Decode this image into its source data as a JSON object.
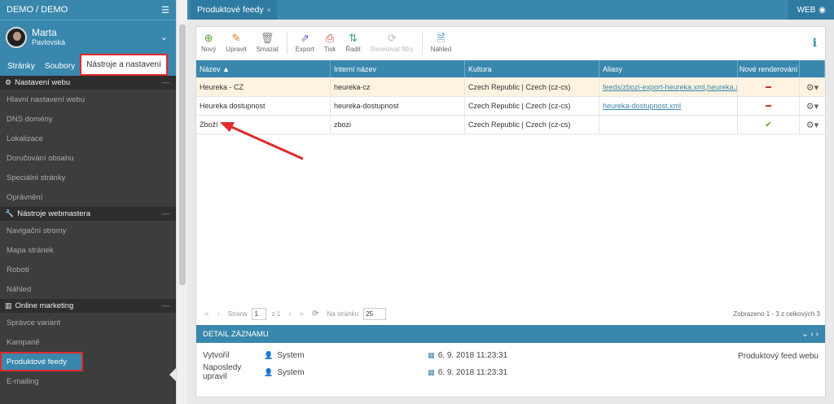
{
  "sidebar": {
    "brand": "DEMO / DEMO",
    "user_first": "Marta",
    "user_last": "Pavlovská",
    "tabs": [
      "Stránky",
      "Soubory",
      "Nástroje a nastavení"
    ],
    "section1": "Nastavení webu",
    "section1_items": [
      "Hlavní nastavení webu",
      "DNS domény",
      "Lokalizace",
      "Doručování obsahu",
      "Speciální stránky",
      "Oprávnění"
    ],
    "section2": "Nástroje webmastera",
    "section2_items": [
      "Navigační stromy",
      "Mapa stránek",
      "Roboti",
      "Náhled"
    ],
    "section3": "Online marketing",
    "section3_items": [
      "Správce variant",
      "Kampaně",
      "Produktové feedy",
      "E-mailing"
    ]
  },
  "topbar": {
    "tab": "Produktové feedy",
    "web_label": "WEB"
  },
  "toolbar": [
    "Nový",
    "Upravit",
    "Smazat",
    "Export",
    "Tisk",
    "Řadit",
    "Resetovat filtry",
    "Náhled"
  ],
  "grid": {
    "headers": [
      "Název ▲",
      "Interní název",
      "Kultura",
      "Aliasy",
      "Nové renderování"
    ],
    "rows": [
      {
        "name": "Heureka - CZ",
        "internal": "heureka-cz",
        "culture": "Czech Republic | Czech (cz-cs)",
        "alias1": "feeds/zbozi-export-heureka.xml",
        "alias_sep": ", ",
        "alias2": "heureka.xml",
        "render": "no"
      },
      {
        "name": "Heureka dostupnost",
        "internal": "heureka-dostupnost",
        "culture": "Czech Republic | Czech (cz-cs)",
        "alias1": "heureka-dostupnost.xml",
        "alias_sep": "",
        "alias2": "",
        "render": "no"
      },
      {
        "name": "Zboží",
        "internal": "zbozi",
        "culture": "Czech Republic | Czech (cz-cs)",
        "alias1": "",
        "alias_sep": "",
        "alias2": "",
        "render": "yes"
      }
    ]
  },
  "pager": {
    "page_label": "Strana",
    "page": "1",
    "of": "z 1",
    "per_page_label": "Na stránku",
    "per_page": "25",
    "total": "Zobrazeno 1 - 3 z celkových 3"
  },
  "detail": {
    "title": "DETAIL ZÁZNAMU",
    "created_label": "Vytvořil",
    "created_by": "System",
    "created_at": "6. 9. 2018 11:23:31",
    "updated_label": "Naposledy upravil",
    "updated_by": "System",
    "updated_at": "6. 9. 2018 11:23:31",
    "type": "Produktový feed webu"
  },
  "colors": {
    "accent": "#3a87ad",
    "highlight": "#e02b2b"
  }
}
